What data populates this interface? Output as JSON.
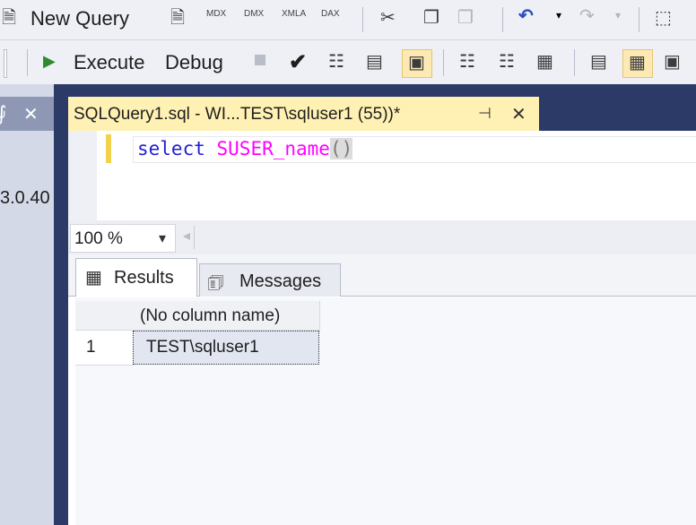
{
  "toolbar1": {
    "new_query_label": "New Query"
  },
  "toolbar2": {
    "execute_label": "Execute",
    "debug_label": "Debug"
  },
  "left_panel": {
    "close_glyph": "✕",
    "version_fragment": "3.0.40"
  },
  "editor_tab": {
    "title": "SQLQuery1.sql - WI...TEST\\sqluser1 (55))*",
    "pin_glyph": "⊣",
    "close_glyph": "✕"
  },
  "editor": {
    "keyword": "select",
    "function_name": "SUSER_name",
    "parens": "()"
  },
  "zoom": {
    "value": "100 %",
    "arrow": "▾"
  },
  "result_tabs": [
    {
      "label": "Results",
      "icon": "grid-icon"
    },
    {
      "label": "Messages",
      "icon": "messages-icon"
    }
  ],
  "grid": {
    "column_header": "(No column name)",
    "rows": [
      {
        "num": "1",
        "value": "TEST\\sqluser1"
      }
    ]
  },
  "colors": {
    "keyword": "#1f1fd6",
    "function": "#ff00ff",
    "parens": "#7a7a7a",
    "dark_blue": "#2b3a66",
    "tab_yellow": "#fff1b3"
  }
}
